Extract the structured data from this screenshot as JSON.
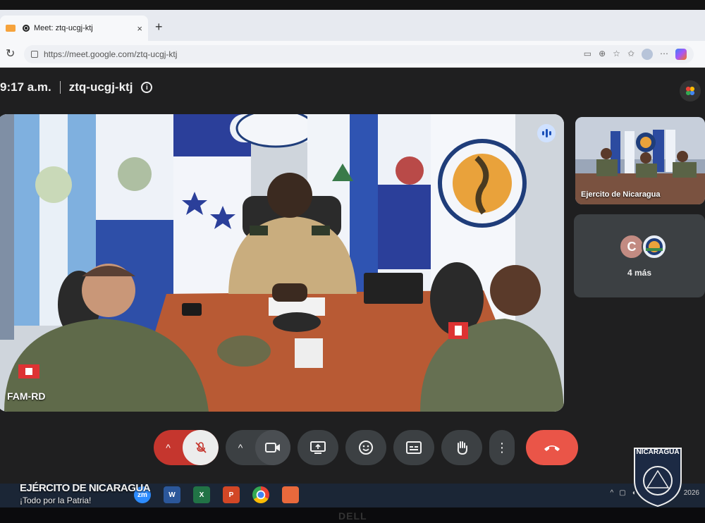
{
  "browser": {
    "tab_title": "Meet: ztq-ucgj-ktj",
    "tab_close": "×",
    "new_tab": "+",
    "url": "https://meet.google.com/ztq-ucgj-ktj"
  },
  "meet": {
    "time": "9:17 a.m.",
    "meeting_code": "ztq-ucgj-ktj",
    "info_glyph": "i",
    "main_participant": "FAM-RD",
    "side_participant": "Ejercito de Nicaragua",
    "avatar_initial": "C",
    "more_participants": "4 más"
  },
  "controls": {
    "mic_state": "muted",
    "camera_state": "on",
    "hangup_color": "#ea5548",
    "mic_color": "#c5362e"
  },
  "taskbar": {
    "zoom_label": "zm",
    "word_label": "W",
    "excel_label": "X",
    "ppt_label": "P",
    "tray_year": "2026"
  },
  "watermark": {
    "line1": "EJÉRCITO DE NICARAGUA",
    "line2": "¡Todo por la Patria!",
    "badge_top": "NICARAGUA"
  },
  "icons": [
    "camera-icon",
    "record-icon",
    "reload-icon",
    "lock-icon",
    "info-icon",
    "apps-icon",
    "speaking-icon",
    "mic-off-icon",
    "video-icon",
    "present-icon",
    "emoji-icon",
    "captions-icon",
    "raise-hand-icon",
    "more-icon",
    "hangup-icon"
  ]
}
